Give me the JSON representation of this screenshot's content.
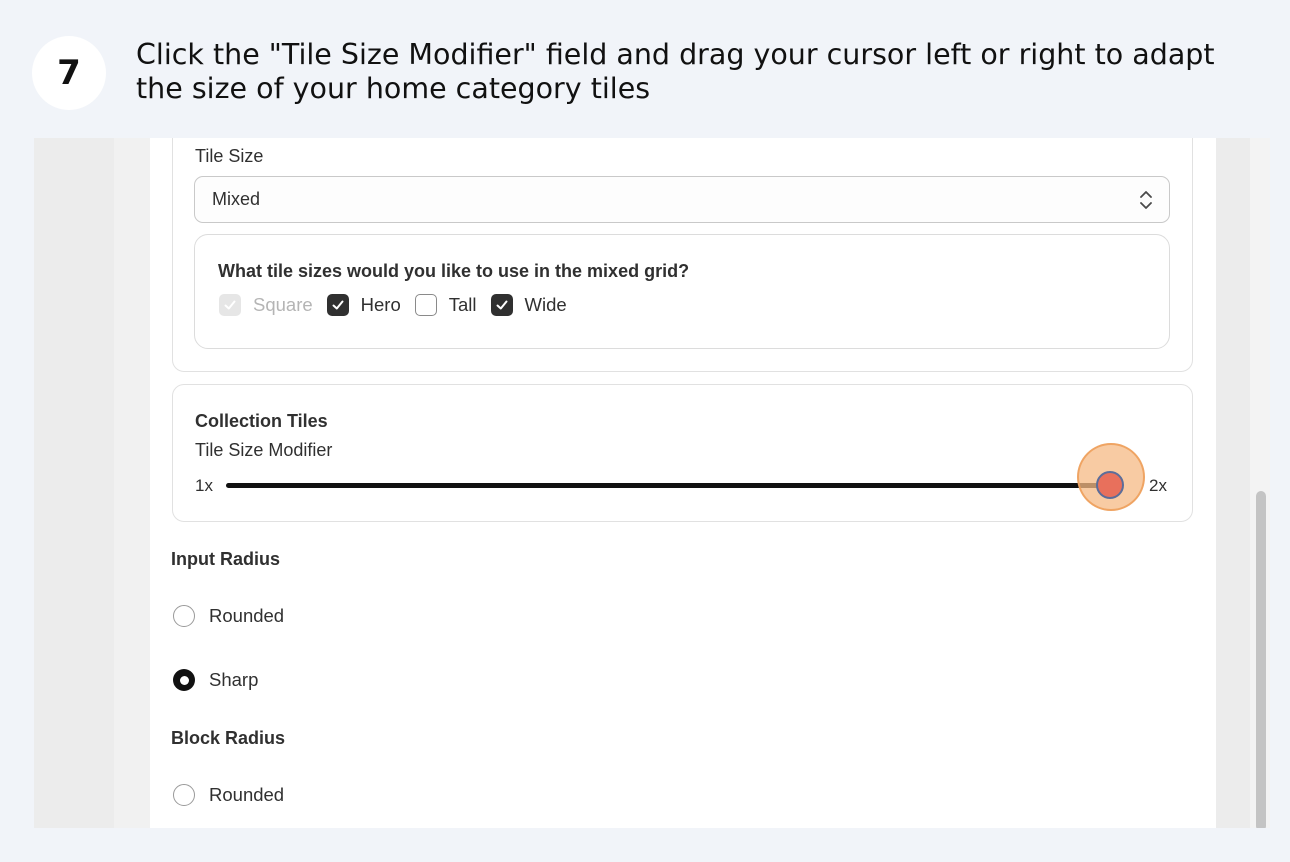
{
  "step": {
    "number": "7",
    "instruction": "Click the \"Tile Size Modifier\" field and drag your cursor left or right to adapt the size of your home category tiles"
  },
  "tile_size": {
    "label": "Tile Size",
    "selected_value": "Mixed",
    "mixed_grid": {
      "question": "What tile sizes would you like to use in the mixed grid?",
      "options": [
        {
          "label": "Square",
          "checked": true,
          "disabled": true
        },
        {
          "label": "Hero",
          "checked": true,
          "disabled": false
        },
        {
          "label": "Tall",
          "checked": false,
          "disabled": false
        },
        {
          "label": "Wide",
          "checked": true,
          "disabled": false
        }
      ]
    }
  },
  "collection_tiles": {
    "title": "Collection Tiles",
    "slider_label": "Tile Size Modifier",
    "min_label": "1x",
    "max_label": "2x",
    "value_fraction": 1.0
  },
  "input_radius": {
    "title": "Input Radius",
    "options": [
      {
        "label": "Rounded",
        "selected": false
      },
      {
        "label": "Sharp",
        "selected": true
      }
    ]
  },
  "block_radius": {
    "title": "Block Radius",
    "options": [
      {
        "label": "Rounded",
        "selected": false
      }
    ]
  },
  "colors": {
    "highlight": "#f6ba84",
    "slider_thumb": "#e8705c",
    "checked_fill": "#303030"
  },
  "icons": [
    "step-number-badge",
    "select-chevron-icon",
    "checkmark-icon",
    "slider-thumb"
  ]
}
